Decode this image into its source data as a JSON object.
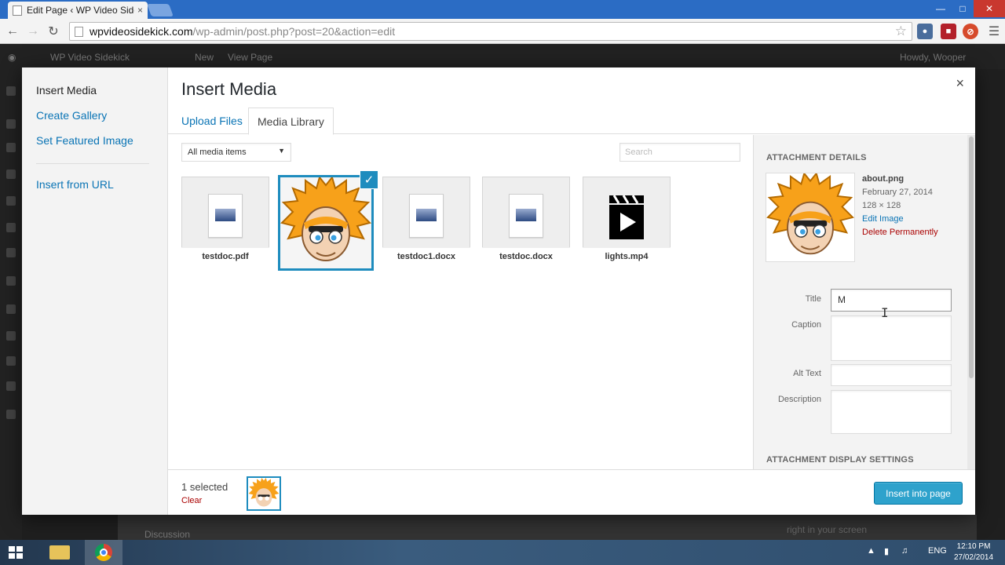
{
  "browser": {
    "tab_title": "Edit Page ‹ WP Video Side",
    "tab_close": "×",
    "url_host": "wpvideosidekick.com",
    "url_path": "/wp-admin/post.php?post=20&action=edit"
  },
  "wp": {
    "adminbar_site": "WP Video Sidekick",
    "adminbar_new": "New",
    "adminbar_view": "View Page",
    "adminbar_user": "Howdy, Wooper",
    "discussion": "Discussion",
    "bottom_hint": "right in your screen"
  },
  "modal": {
    "title": "Insert Media",
    "close": "×",
    "menu": [
      "Insert Media",
      "Create Gallery",
      "Set Featured Image",
      "Insert from URL"
    ],
    "tabs": [
      "Upload Files",
      "Media Library"
    ],
    "filter_selected": "All media items",
    "search_placeholder": "Search",
    "attachments": [
      {
        "filename": "testdoc.pdf",
        "type": "document"
      },
      {
        "filename": "about.png",
        "type": "image",
        "selected": true
      },
      {
        "filename": "testdoc1.docx",
        "type": "document"
      },
      {
        "filename": "testdoc.docx",
        "type": "document"
      },
      {
        "filename": "lights.mp4",
        "type": "video"
      }
    ],
    "details": {
      "heading": "ATTACHMENT DETAILS",
      "filename": "about.png",
      "date": "February 27, 2014",
      "dimensions": "128 × 128",
      "edit_link": "Edit Image",
      "delete_link": "Delete Permanently",
      "title_label": "Title",
      "title_value": "M",
      "caption_label": "Caption",
      "alt_label": "Alt Text",
      "description_label": "Description",
      "display_heading": "ATTACHMENT DISPLAY SETTINGS"
    },
    "footer": {
      "selected_count": "1 selected",
      "clear": "Clear",
      "insert_button": "Insert into page"
    }
  },
  "taskbar": {
    "language": "ENG",
    "time": "12:10 PM",
    "date": "27/02/2014"
  },
  "colors": {
    "accent": "#1e8cbe",
    "link": "#0a74b5",
    "delete": "#a00000",
    "button": "#2ea2cc"
  }
}
